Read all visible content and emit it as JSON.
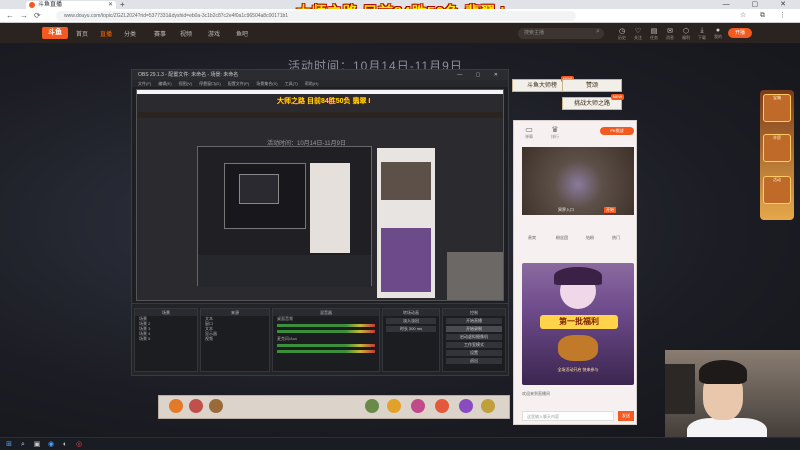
{
  "browser": {
    "tab_title": "斗鱼直播",
    "url": "www.douyu.com/topic/ZGZL2024?rid=5377331&dyshid=eb0a-3c1b2c87c2e4f0a1c96504a8c00171b1",
    "nav": [
      "←",
      "→",
      "⟳"
    ],
    "window_controls": "— ▢ ✕"
  },
  "overlay_title": "大师之路 目前84胜50负 翡翠 I",
  "site": {
    "logo": "斗鱼",
    "nav": [
      "首页",
      "直播",
      "分类",
      "赛事",
      "视频",
      "游戏",
      "鱼吧"
    ],
    "search_placeholder": "搜索主播",
    "header_icons": [
      {
        "name": "history",
        "glyph": "◷",
        "label": "历史"
      },
      {
        "name": "follow",
        "glyph": "♡",
        "label": "关注"
      },
      {
        "name": "task",
        "glyph": "▤",
        "label": "任务"
      },
      {
        "name": "message",
        "glyph": "✉",
        "label": "消息"
      },
      {
        "name": "gift",
        "glyph": "⬡",
        "label": "福利"
      },
      {
        "name": "download",
        "glyph": "⤓",
        "label": "下载"
      },
      {
        "name": "avatar",
        "glyph": "●",
        "label": "我的"
      }
    ],
    "open_live": "开播"
  },
  "activity_time": "活动时间：10月14日-11月9日",
  "obs": {
    "title": "OBS 29.1.3 - 配置文件: 未命名 - 场景: 未命名",
    "menu": "文件(F) 编辑(E) 视图(V) 停靠窗口(D) 配置文件(P) 场景集合(S) 工具(T) 帮助(H)",
    "preview_title": "大师之路 目前84胜50负 翡翠 I",
    "preview_time": "活动时间：10月14日-11月9日",
    "panels": {
      "scenes": {
        "title": "场景",
        "items": [
          "场景",
          "场景 2",
          "场景 3",
          "场景 4",
          "场景 5"
        ]
      },
      "sources": {
        "title": "来源",
        "items": [
          "文本",
          "窗口",
          "文本",
          "显示器",
          "视频"
        ]
      },
      "mixer": {
        "title": "混音器",
        "items": [
          "桌面音频",
          "麦克风/Aux"
        ]
      },
      "transitions": {
        "title": "转场动画",
        "items": [
          "淡入淡出",
          "时长 300 ms"
        ]
      },
      "controls": {
        "title": "控制",
        "items": [
          "开始直播",
          "开始录制",
          "启动虚拟摄像机",
          "工作室模式",
          "设置",
          "退出"
        ]
      }
    }
  },
  "side_labels": [
    {
      "text": "斗鱼大师榜",
      "badge": "NEW"
    },
    {
      "text": "赞颂",
      "badge": ""
    },
    {
      "text": "挑战大师之路",
      "badge": "NEW"
    }
  ],
  "live_panel": {
    "icons": [
      {
        "name": "chat",
        "glyph": "▭",
        "label": "弹幕"
      },
      {
        "name": "rank",
        "glyph": "♛",
        "label": "排行"
      }
    ],
    "pk_button": "PK挑战",
    "game_caption": "冥界入口",
    "game_tag": "开始",
    "tabs": [
      "贵宾",
      "粉丝团",
      "钻粉",
      "热门"
    ],
    "poster_title": "第一批福利",
    "poster_sub": "全场活动开启 快来参与",
    "chat_row": "欢迎来到直播间",
    "input_placeholder": "这里输入聊天内容",
    "send": "发送"
  },
  "promo": [
    "宝箱",
    "许愿",
    "活动"
  ],
  "taskbar": [
    "⊞",
    "⌕",
    "▣",
    "◉",
    "◐",
    "◎"
  ],
  "colors": {
    "brand": "#f35a1f",
    "overlay_text": "#ffe600",
    "overlay_stroke": "#b00000"
  }
}
